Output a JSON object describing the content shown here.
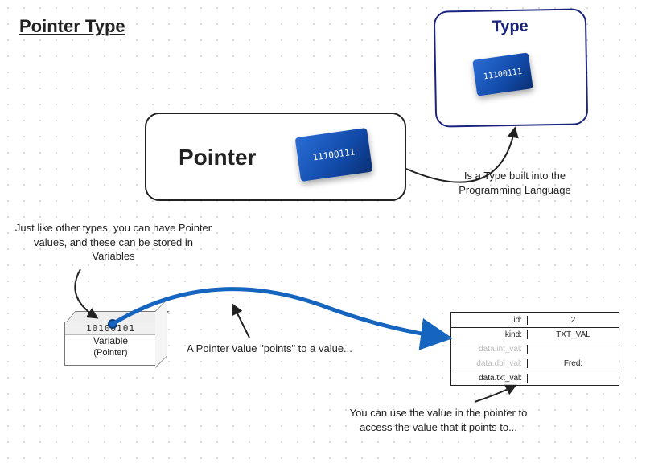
{
  "title": "Pointer Type",
  "type_box": {
    "label": "Type"
  },
  "pointer_box": {
    "label": "Pointer"
  },
  "chip_text": "11100111",
  "notes": {
    "type": "Is a Type built into the Programming Language",
    "var": "Just like other types, you can have Pointer values, and these can be stored in Variables",
    "points": "A Pointer value \"points\" to a value...",
    "use": "You can use the value in the pointer to access the value that it points to..."
  },
  "variable": {
    "bits": "10100101",
    "name": "Variable",
    "sub": "(Pointer)"
  },
  "struct": {
    "rows": [
      {
        "k": "id:",
        "v": "2",
        "dim": false
      },
      {
        "k": "kind:",
        "v": "TXT_VAL",
        "dim": false
      },
      {
        "k": "data.int_val:",
        "v": "",
        "dim": true
      },
      {
        "k": "data.dbl_val:",
        "v": "Fred:",
        "dim": true
      },
      {
        "k": "data.txt_val:",
        "v": "",
        "dim": false
      }
    ]
  }
}
